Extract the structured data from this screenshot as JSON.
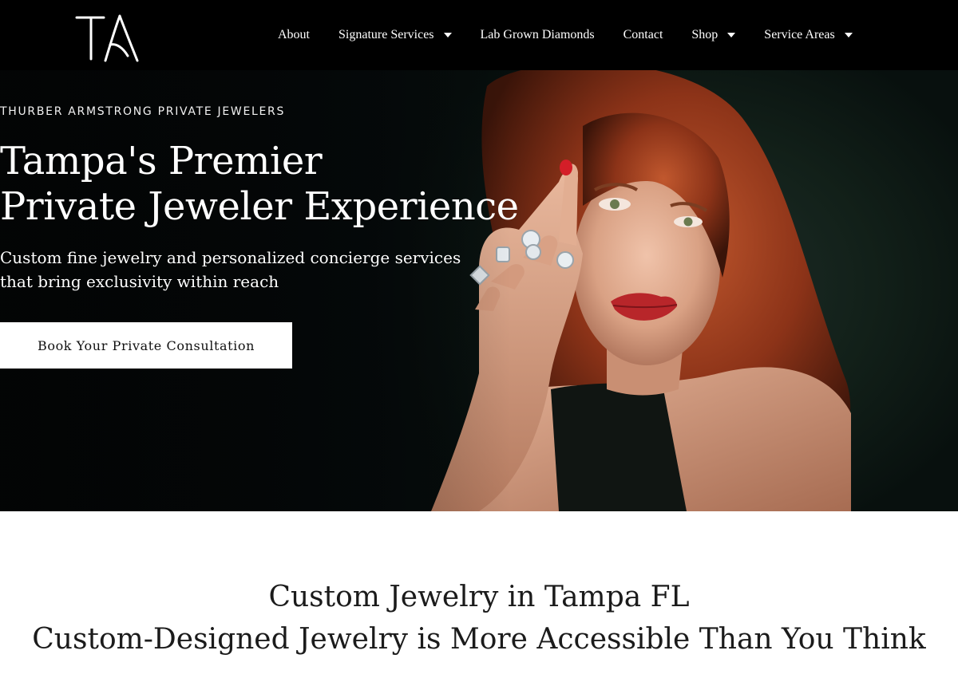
{
  "brand": {
    "logo_text": "TA"
  },
  "nav": {
    "items": [
      {
        "label": "About",
        "has_dropdown": false
      },
      {
        "label": "Signature Services",
        "has_dropdown": true
      },
      {
        "label": "Lab Grown Diamonds",
        "has_dropdown": false
      },
      {
        "label": "Contact",
        "has_dropdown": false
      },
      {
        "label": "Shop",
        "has_dropdown": true
      },
      {
        "label": "Service Areas",
        "has_dropdown": true
      }
    ]
  },
  "hero": {
    "eyebrow": "THURBER ARMSTRONG PRIVATE JEWELERS",
    "title_line1": "Tampa's Premier",
    "title_line2": "Private Jeweler Experience",
    "subtitle_line1": "Custom fine jewelry and personalized concierge services",
    "subtitle_line2": "that bring exclusivity within reach",
    "cta_label": "Book Your Private Consultation"
  },
  "section": {
    "heading1": "Custom Jewelry in Tampa FL",
    "heading2": "Custom-Designed Jewelry is More Accessible Than You Think"
  },
  "colors": {
    "nav_bg": "#000000",
    "hero_bg": "#06100d",
    "cta_bg": "#ffffff",
    "text_light": "#ffffff",
    "text_dark": "#1b1b1b"
  }
}
